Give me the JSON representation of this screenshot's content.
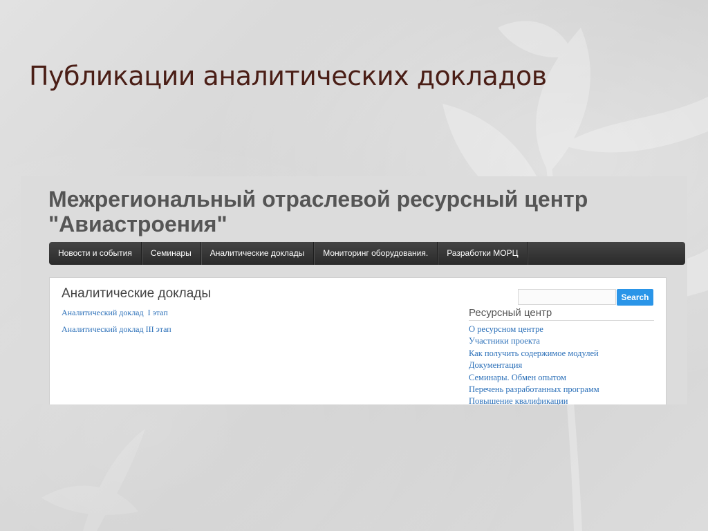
{
  "slide": {
    "title": "Публикации аналитических докладов"
  },
  "site": {
    "title_line1": "Межрегиональный отраслевой ресурсный центр",
    "title_line2": "\"Авиастроения\""
  },
  "nav": {
    "items": [
      {
        "label": "Новости и события"
      },
      {
        "label": "Семинары"
      },
      {
        "label": "Аналитические доклады"
      },
      {
        "label": "Мониторинг оборудования."
      },
      {
        "label": "Разработки МОРЦ"
      }
    ]
  },
  "main": {
    "heading": "Аналитические доклады",
    "links": [
      {
        "label": "Аналитический доклад  I этап"
      },
      {
        "label": "Аналитический доклад III этап"
      }
    ]
  },
  "search": {
    "value": "",
    "button_label": "Search"
  },
  "sidebar": {
    "heading": "Ресурсный центр",
    "items": [
      {
        "label": "О ресурсном центре"
      },
      {
        "label": "Участники проекта"
      },
      {
        "label": "Как получить содержимое модулей"
      },
      {
        "label": "Документация"
      },
      {
        "label": "Семинары. Обмен опытом"
      },
      {
        "label": "Перечень разработанных программ"
      },
      {
        "label": "Повышение квалификации"
      }
    ]
  },
  "colors": {
    "slide_title": "#4a1e16",
    "link": "#2a6fb8",
    "search_button": "#2a95e8",
    "navbar": "#333333"
  },
  "icons": [
    "plant-silhouette-decoration"
  ]
}
